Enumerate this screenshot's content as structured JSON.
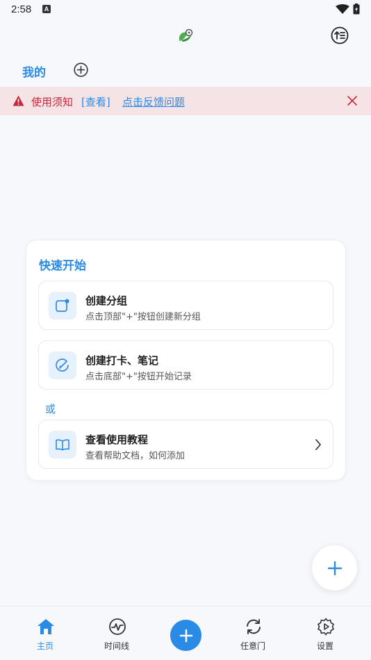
{
  "status_bar": {
    "time": "2:58",
    "a_icon": "A"
  },
  "tabs": {
    "mine_label": "我的"
  },
  "notice": {
    "text": "使用须知",
    "view_link": "[查看]",
    "feedback_link": "点击反馈问题"
  },
  "quick_start": {
    "title": "快速开始",
    "items": [
      {
        "title": "创建分组",
        "desc": "点击顶部\"+\"按钮创建新分组",
        "icon": "new-group-icon"
      },
      {
        "title": "创建打卡、笔记",
        "desc": "点击底部\"+\"按钮开始记录",
        "icon": "edit-note-icon"
      }
    ],
    "or_label": "或",
    "tutorial": {
      "title": "查看使用教程",
      "desc": "查看帮助文档，如何添加",
      "icon": "book-icon"
    }
  },
  "bottom_nav": {
    "items": [
      {
        "label": "主页",
        "icon": "home-icon"
      },
      {
        "label": "时间线",
        "icon": "timeline-icon"
      },
      {
        "label": "任意门",
        "icon": "sync-icon"
      },
      {
        "label": "设置",
        "icon": "settings-icon"
      }
    ]
  },
  "colors": {
    "accent": "#2a8be6",
    "warning": "#c7263b",
    "banner_bg": "#f6e3e5"
  }
}
